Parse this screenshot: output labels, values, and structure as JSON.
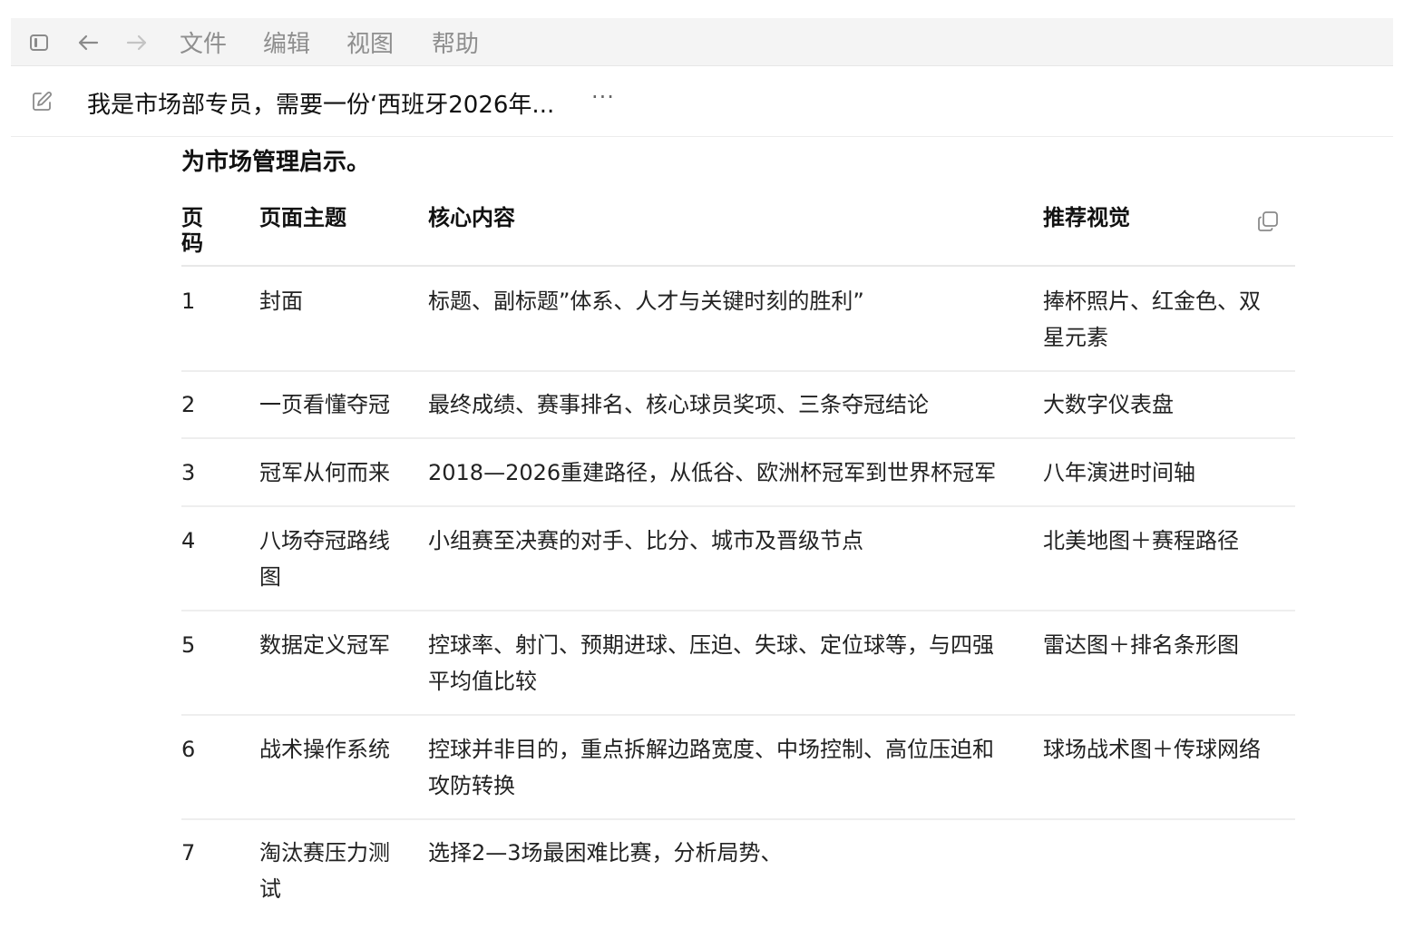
{
  "menubar": {
    "icons": [
      "sidebar-toggle-icon",
      "arrow-left-icon",
      "arrow-right-icon"
    ],
    "menu": [
      "文件",
      "编辑",
      "视图",
      "帮助"
    ]
  },
  "conversation": {
    "title": "我是市场部专员，需要一份‘西班牙2026年...",
    "more": "···"
  },
  "content": {
    "heading": "为市场管理启示。",
    "table": {
      "headers": [
        "页码",
        "页面主题",
        "核心内容",
        "推荐视觉"
      ],
      "rows": [
        {
          "page": "1",
          "topic": "封面",
          "content": "标题、副标题”体系、人才与关键时刻的胜利”",
          "visual": "捧杯照片、红金色、双星元素"
        },
        {
          "page": "2",
          "topic": "一页看懂夺冠",
          "content": "最终成绩、赛事排名、核心球员奖项、三条夺冠结论",
          "visual": "大数字仪表盘"
        },
        {
          "page": "3",
          "topic": "冠军从何而来",
          "content": "2018—2026重建路径，从低谷、欧洲杯冠军到世界杯冠军",
          "visual": "八年演进时间轴"
        },
        {
          "page": "4",
          "topic": "八场夺冠路线图",
          "content": "小组赛至决赛的对手、比分、城市及晋级节点",
          "visual": "北美地图＋赛程路径"
        },
        {
          "page": "5",
          "topic": "数据定义冠军",
          "content": "控球率、射门、预期进球、压迫、失球、定位球等，与四强平均值比较",
          "visual": "雷达图＋排名条形图"
        },
        {
          "page": "6",
          "topic": "战术操作系统",
          "content": "控球并非目的，重点拆解边路宽度、中场控制、高位压迫和攻防转换",
          "visual": "球场战术图＋传球网络"
        },
        {
          "page": "7",
          "topic": "淘汰赛压力测试",
          "content": "选择2—3场最困难比赛，分析局势、",
          "visual": ""
        }
      ]
    }
  }
}
